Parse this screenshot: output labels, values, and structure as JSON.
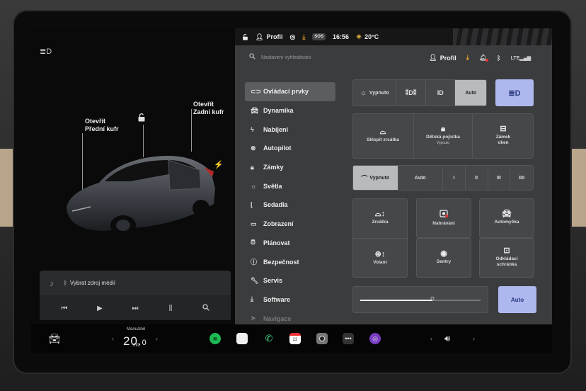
{
  "status": {
    "profile": "Profil",
    "sos": "SOS",
    "time": "16:56",
    "temperature": "20°C"
  },
  "search": {
    "placeholder": "Nastavení vyhledávání",
    "profile": "Profil"
  },
  "car": {
    "front_trunk_line1": "Otevřít",
    "front_trunk_line2": "Přední kufr",
    "rear_trunk_line1": "Otevřít",
    "rear_trunk_line2": "Zadní kufr"
  },
  "media": {
    "source": "Vybrat zdroj médií"
  },
  "menu": [
    {
      "label": "Ovládací prvky",
      "icon": "toggle-icon"
    },
    {
      "label": "Dynamika",
      "icon": "car-icon"
    },
    {
      "label": "Nabíjení",
      "icon": "bolt-icon"
    },
    {
      "label": "Autopilot",
      "icon": "steering-wheel-icon"
    },
    {
      "label": "Zámky",
      "icon": "lock-icon"
    },
    {
      "label": "Světla",
      "icon": "sun-icon"
    },
    {
      "label": "Sedadla",
      "icon": "seat-icon"
    },
    {
      "label": "Zobrazení",
      "icon": "display-icon"
    },
    {
      "label": "Plánovat",
      "icon": "clock-icon"
    },
    {
      "label": "Bezpečnost",
      "icon": "shield-icon"
    },
    {
      "label": "Servis",
      "icon": "wrench-icon"
    },
    {
      "label": "Software",
      "icon": "download-icon"
    },
    {
      "label": "Navigace",
      "icon": "navigation-icon"
    }
  ],
  "lights": {
    "off": "Vypnuto",
    "auto": "Auto"
  },
  "tiles_top": {
    "fold_mirrors": "Sklopit zrcátka",
    "child_lock": "Dětská pojistka",
    "child_lock_state": "Vypnuto",
    "window_lock_1": "Zámek",
    "window_lock_2": "oken"
  },
  "wipers": {
    "off": "Vypnuto",
    "auto": "Auto",
    "s1": "I",
    "s2": "II",
    "s3": "III",
    "s4": "IIII"
  },
  "tiles_grid": {
    "mirrors": "Zrcátka",
    "recording": "Nahrávání",
    "carwash": "Automyčka",
    "steering": "Volant",
    "sentry": "Sentry",
    "glovebox_1": "Odkládací",
    "glovebox_2": "schránka"
  },
  "brightness": {
    "auto": "Auto",
    "level": 0.6
  },
  "dock": {
    "mode_label": "Manuálně",
    "temp_main": "20.",
    "temp_dec": "0",
    "calendar_day": "22"
  }
}
